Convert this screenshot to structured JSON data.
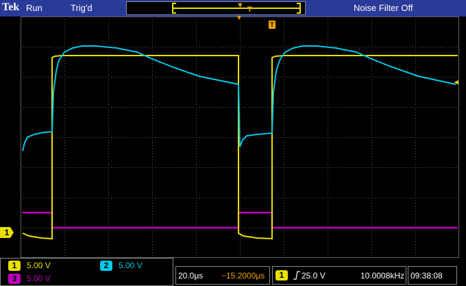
{
  "header": {
    "brand": "Tek",
    "run_status": "Run",
    "trigger_status": "Trig'd",
    "noise_filter": "Noise Filter Off"
  },
  "markers": {
    "trigger_position_symbol": "T",
    "ch1_ground_label": "1"
  },
  "channels": [
    {
      "badge": "1",
      "scale": "5.00 V",
      "color": "#e8e000"
    },
    {
      "badge": "2",
      "scale": "5.00 V",
      "color": "#00c8e8"
    },
    {
      "badge": "3",
      "scale": "5.00 V",
      "color": "#c000c0"
    }
  ],
  "timebase": {
    "scale": "20.0μs",
    "position": "−15.2000μs"
  },
  "trigger": {
    "source_badge": "1",
    "slope_icon": "rising-edge-icon",
    "level": "25.0 V",
    "frequency": "10.0008kHz"
  },
  "clock": "09:38:08",
  "colors": {
    "header_bg": "#2a3a99",
    "grid": "#606060",
    "ch1": "#e8e000",
    "ch2": "#00c8e8",
    "ch3": "#c000c0",
    "accent_orange": "#f0a000"
  }
}
